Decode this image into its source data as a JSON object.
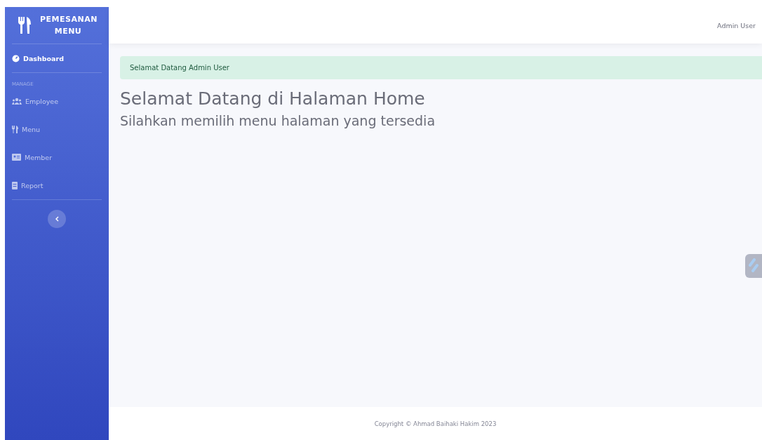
{
  "brand": {
    "title": "PEMESANAN MENU"
  },
  "sidebar": {
    "items": [
      {
        "kind": "dashboard",
        "label": "Dashboard",
        "selected": true
      }
    ],
    "heading": "MANAGE",
    "manage_items": [
      {
        "kind": "employee",
        "label": "Employee",
        "selected": false
      },
      {
        "kind": "menu",
        "label": "Menu",
        "selected": false
      },
      {
        "kind": "member",
        "label": "Member",
        "selected": false
      },
      {
        "kind": "report",
        "label": "Report",
        "selected": false
      }
    ]
  },
  "topbar": {
    "user": "Admin User"
  },
  "alert": "Selamat Datang Admin User",
  "heading": "Selamat Datang di Halaman Home",
  "subheading": "Silahkan memilih menu halaman yang tersedia",
  "footer": "Copyright © Ahmad Baihaki Hakim 2023"
}
